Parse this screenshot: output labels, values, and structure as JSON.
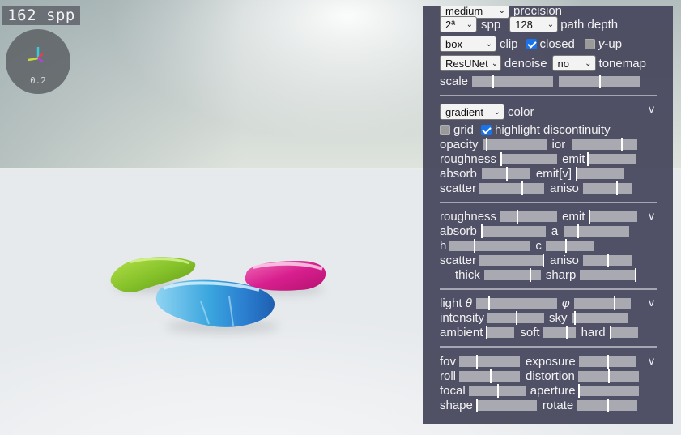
{
  "overlay": {
    "spp_counter": "162 spp",
    "gizmo_scale": "0.2"
  },
  "render": {
    "precision_select": "medium",
    "precision_label": "precision",
    "spp_select": "2ª",
    "spp_label": "spp",
    "path_depth_select": "128",
    "path_depth_label": "path depth",
    "clip_select": "box",
    "clip_label": "clip",
    "closed_label": "closed",
    "closed_checked": true,
    "yup_label_y": "y",
    "yup_label_rest": "-up",
    "yup_checked": false,
    "denoise_select": "ResUNet",
    "denoise_label": "denoise",
    "tonemap_select": "no",
    "tonemap_label": "tonemap",
    "scale_label": "scale",
    "scale_values": [
      0.25,
      0.5
    ]
  },
  "material": {
    "color_select": "gradient",
    "color_label": "color",
    "toggle": "v",
    "grid_label": "grid",
    "grid_checked": false,
    "highlight_label": "highlight discontinuity",
    "highlight_checked": true,
    "opacity_label": "opacity",
    "opacity": 0.05,
    "ior_label": "ior",
    "ior": 0.75,
    "roughness_label": "roughness",
    "roughness": 0.0,
    "emit_label": "emit",
    "emit": 0.0,
    "absorb_label": "absorb",
    "absorb": 0.5,
    "emitv_label": "emit[v]",
    "emitv": 0.0,
    "scatter_label": "scatter",
    "scatter": 0.65,
    "aniso_label": "aniso",
    "aniso": 0.68
  },
  "material2": {
    "toggle": "v",
    "roughness_label": "roughness",
    "roughness": 0.29,
    "emit_label": "emit",
    "emit": 0.0,
    "absorb_label": "absorb",
    "absorb": 0.0,
    "a_label": "a",
    "a": 0.2,
    "h_label": "h",
    "h": 0.3,
    "c_label": "c",
    "c": 0.4,
    "scatter_label": "scatter",
    "scatter": 0.99,
    "aniso_label": "aniso",
    "aniso": 0.5,
    "thick_label": "thick",
    "thick": 0.8,
    "sharp_label": "sharp",
    "sharp": 0.99
  },
  "light": {
    "toggle": "v",
    "theta_label_pre": "light ",
    "theta_symbol": "θ",
    "theta": 0.15,
    "phi_symbol": "φ",
    "phi": 0.7,
    "intensity_label": "intensity",
    "intensity": 0.5,
    "sky_label": "sky",
    "sky": 0.05,
    "ambient_label": "ambient",
    "ambient": 0.0,
    "soft_label": "soft",
    "soft": 0.7,
    "hard_label": "hard",
    "hard": 0.0
  },
  "camera": {
    "toggle": "v",
    "fov_label": "fov",
    "fov": 0.28,
    "exposure_label": "exposure",
    "exposure": 0.5,
    "roll_label": "roll",
    "roll": 0.5,
    "distortion_label": "distortion",
    "distortion": 0.5,
    "focal_label": "focal",
    "focal": 0.5,
    "aperture_label": "aperture",
    "aperture": 0.0,
    "shape_label": "shape",
    "shape": 0.0,
    "rotate_label": "rotate",
    "rotate": 0.5
  },
  "colors": {
    "panel_bg": "#4a4a60",
    "slider_track": "#a9a9b1",
    "checkbox_on": "#1a73e8"
  }
}
